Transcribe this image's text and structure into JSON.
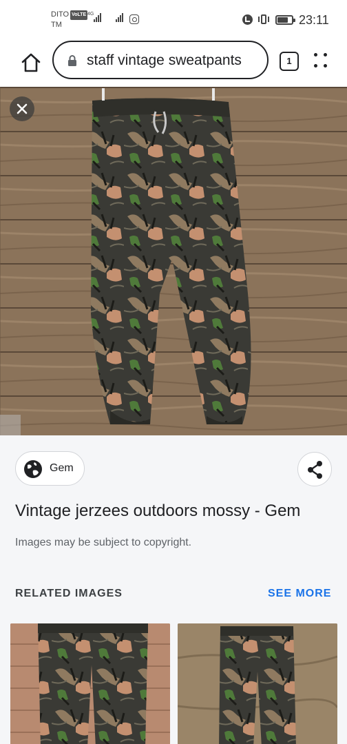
{
  "status_bar": {
    "carrier_line1": "DITO",
    "volte_badge": "VoLTE",
    "carrier_line2": "TM",
    "network": "4G",
    "time": "23:11",
    "battery_level": 0.75
  },
  "toolbar": {
    "search_query": "staff vintage sweatpants",
    "tab_count": "1"
  },
  "result": {
    "source_name": "Gem",
    "title": "Vintage jerzees outdoors mossy - Gem",
    "copyright_notice": "Images may be subject to copyright."
  },
  "related": {
    "heading": "RELATED IMAGES",
    "see_more_label": "SEE MORE"
  },
  "icons": {
    "home": "home-icon",
    "lock": "lock-icon",
    "menu": "more-vert-icon",
    "close": "close-icon",
    "globe": "globe-icon",
    "share": "share-icon"
  },
  "colors": {
    "accent_link": "#1a73e8",
    "text_primary": "#202124",
    "text_secondary": "#5f6368",
    "panel_bg": "#f5f6f8"
  }
}
